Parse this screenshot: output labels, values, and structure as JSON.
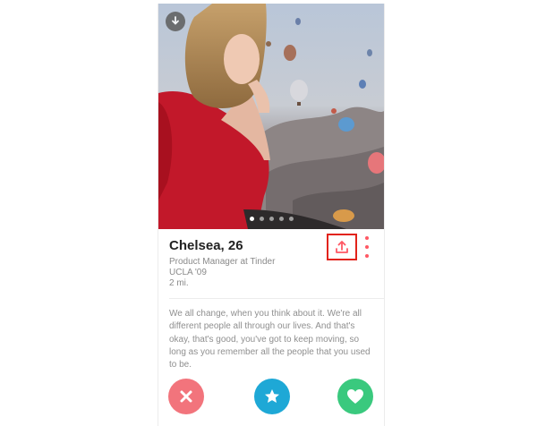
{
  "profile": {
    "name_age": "Chelsea, 26",
    "job": "Product Manager at Tinder",
    "school": "UCLA '09",
    "distance": "2 mi.",
    "bio": "We all change, when you think about it. We're all different people all through our lives. And that's okay, that's good, you've got to keep moving, so long as you remember all the people that you used to be."
  },
  "photo": {
    "description_icon": "download-icon",
    "count": 5,
    "active_index": 0
  },
  "actions": {
    "share_icon": "share-icon",
    "more_icon": "more-vertical-icon",
    "nope_icon": "close-icon",
    "super_like_icon": "star-icon",
    "like_icon": "heart-icon"
  },
  "colors": {
    "highlight": "#e2231a",
    "brand": "#ff5864",
    "nope": "#f2747c",
    "super_like": "#1ea8d6",
    "like": "#3ac97e"
  }
}
